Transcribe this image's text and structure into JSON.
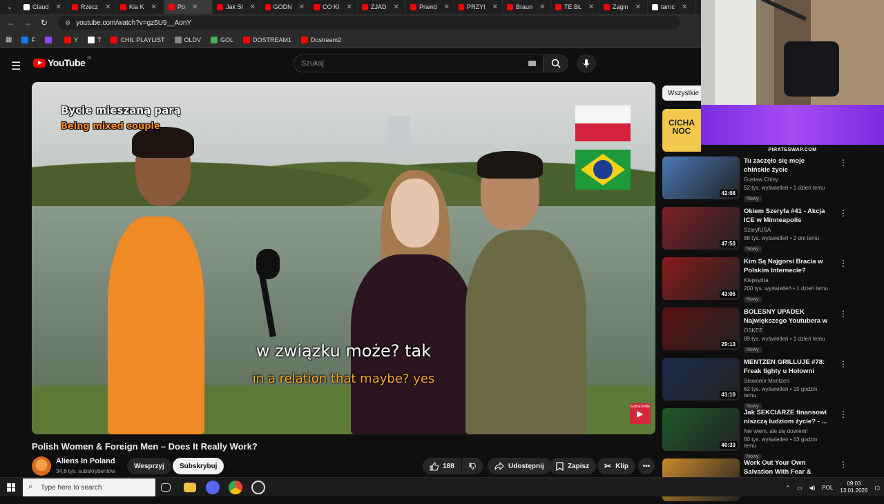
{
  "browser": {
    "tabs": [
      {
        "label": "Claud",
        "color": "#ffffff"
      },
      {
        "label": "Rzecz",
        "color": "#ff0000"
      },
      {
        "label": "Kia K",
        "color": "#ff0000"
      },
      {
        "label": "Po",
        "color": "#ff0000"
      },
      {
        "label": "Jak Sł",
        "color": "#ff0000"
      },
      {
        "label": "GODN",
        "color": "#ff0000"
      },
      {
        "label": "CO KI",
        "color": "#ff0000"
      },
      {
        "label": "ZJAD",
        "color": "#ff0000"
      },
      {
        "label": "Prawd",
        "color": "#ff0000"
      },
      {
        "label": "PRZYI",
        "color": "#ff0000"
      },
      {
        "label": "Braun",
        "color": "#ff0000"
      },
      {
        "label": "TE BŁ",
        "color": "#ff0000"
      },
      {
        "label": "Zagin",
        "color": "#ff0000"
      },
      {
        "label": "tarnc",
        "color": "#ffffff"
      }
    ],
    "url": "youtube.com/watch?v=gz5U9__AonY",
    "bookmarks": [
      {
        "label": "F",
        "color": "#1877f2"
      },
      {
        "label": "",
        "color": "#9146ff"
      },
      {
        "label": "Y",
        "color": "#ff0000"
      },
      {
        "label": "T",
        "color": "#ffffff"
      },
      {
        "label": "CHIL PLAYLIST",
        "color": "#ff0000"
      },
      {
        "label": "OLDV",
        "color": "#888888"
      },
      {
        "label": "GOL",
        "color": "#4caf50"
      },
      {
        "label": "DOSTREAM1",
        "color": "#ff0000"
      },
      {
        "label": "Dostream2",
        "color": "#ff0000"
      }
    ]
  },
  "youtube": {
    "logo_text": "YouTube",
    "logo_region": "PL",
    "search_placeholder": "Szukaj",
    "filter_chip": "Wszystkie"
  },
  "video": {
    "caption_title_pl": "Bycie mieszaną parą",
    "caption_title_en": "Being mixed couple",
    "subtitle_pl": "w związku może? tak",
    "subtitle_en": "in a relation that maybe? yes",
    "subscribe_overlay": "SUBSCRIBE",
    "title": "Polish Women & Foreign Men – Does It Really Work?",
    "channel_name": "Aliens In Poland",
    "channel_subs": "34,8 tys. subskrybentów",
    "support_label": "Wesprzyj",
    "subscribe_label": "Subskrybuj",
    "like_count": "188",
    "share_label": "Udostępnij",
    "save_label": "Zapisz",
    "clip_label": "Klip"
  },
  "stream_overlay": {
    "banner_label": "PIRATESWAP.COM",
    "promo_tile": "CICHA NOC"
  },
  "recommendations": [
    {
      "title": "Tu zaczęło się moje chińskie życie",
      "channel": "Gustaw Chiny",
      "meta": "52 tys. wyświetleń • 1 dzień temu",
      "badge": "Nowy",
      "duration": "42:08",
      "color": "#4a78b8"
    },
    {
      "title": "Okiem Szeryfa #41 - Akcja ICE w Minneapolis",
      "channel": "SzeryfUSA",
      "meta": "88 tys. wyświetleń • 2 dni temu",
      "badge": "Nowy",
      "duration": "47:50",
      "color": "#7d1f25"
    },
    {
      "title": "Kim Są Najgorsi Bracia w Polskim Internecie?",
      "channel": "Klepsydra",
      "meta": "200 tys. wyświetleń • 1 dzień temu",
      "badge": "Nowy",
      "duration": "43:06",
      "color": "#8a1a1a"
    },
    {
      "title": "BOLESNY UPADEK Największego Youtubera w ...",
      "channel": "OSKEE",
      "meta": "89 tys. wyświetleń • 1 dzień temu",
      "badge": "Nowy",
      "duration": "29:13",
      "color": "#5a1010"
    },
    {
      "title": "MENTZEN GRILLUJE #78: Freak fighty u Hołowni",
      "channel": "Sławomir Mentzen",
      "meta": "62 tys. wyświetleń • 15 godzin temu",
      "badge": "Nowy",
      "duration": "41:10",
      "color": "#1c2b4a"
    },
    {
      "title": "Jak SEKCIARZE finansowi niszczą ludziom życie? - ...",
      "channel": "Nie wiem, ale się dowiem!",
      "meta": "60 tys. wyświetleń • 13 godzin temu",
      "badge": "Nowy",
      "duration": "40:33",
      "color": "#1e5a2a"
    },
    {
      "title": "Work Out Your Own Salvation With Fear & Trembling",
      "channel": "",
      "meta": "",
      "badge": "",
      "duration": "",
      "color": "#c98a2a"
    }
  ],
  "taskbar": {
    "search_placeholder": "Type here to search",
    "language": "POL",
    "time": "09:03",
    "date": "13.01.2026"
  }
}
